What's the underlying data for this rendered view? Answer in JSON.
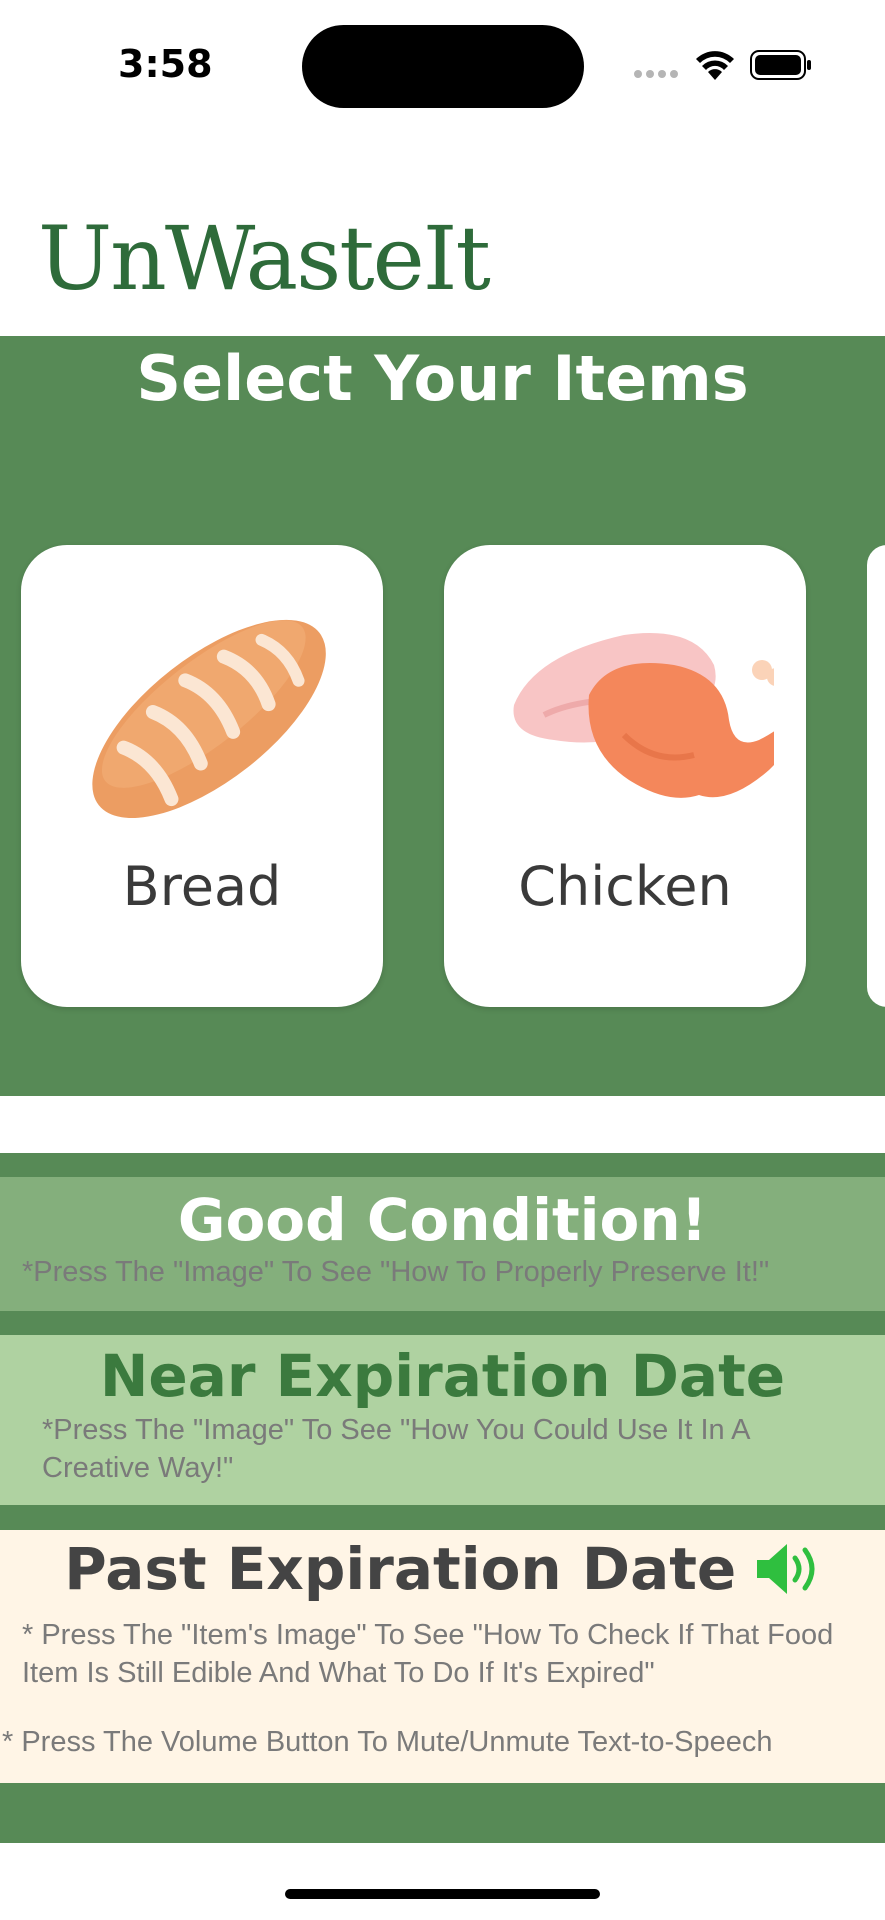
{
  "status_bar": {
    "time": "3:58"
  },
  "app": {
    "logo_text": "UnWasteIt"
  },
  "selection": {
    "title": "Select Your Items",
    "items": [
      {
        "label": "Bread",
        "icon": "bread-icon"
      },
      {
        "label": "Chicken",
        "icon": "chicken-icon"
      }
    ]
  },
  "legend": {
    "good": {
      "title": "Good Condition!",
      "note": "*Press The \"Image\" To See \"How To Properly Preserve It!\""
    },
    "near": {
      "title": "Near Expiration Date",
      "note": "*Press The \"Image\" To See \"How You Could Use It In A Creative Way!\""
    },
    "past": {
      "title": "Past Expiration Date",
      "note": "* Press The \"Item's Image\" To See \"How To Check If That Food Item Is Still Edible And What To Do If It's Expired\"",
      "volume_note": "* Press The Volume Button To Mute/Unmute Text-to-Speech"
    }
  },
  "colors": {
    "brand_green": "#2e6b3a",
    "panel_green": "#578a56",
    "good": "#84af7c",
    "near": "#afd2a1",
    "past": "#fff5e6",
    "speaker_green": "#2fbf3f"
  }
}
